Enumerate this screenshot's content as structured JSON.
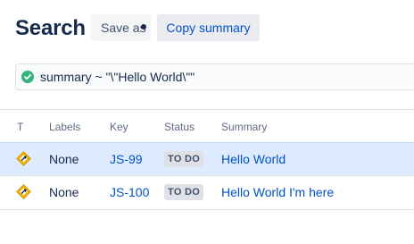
{
  "page": {
    "title": "Search"
  },
  "toolbar": {
    "save_label": "Save as",
    "copy_label": "Copy summary"
  },
  "query": {
    "jql": "summary ~ \"\\\"Hello World\\\"\"",
    "status_color": "#36b37e"
  },
  "table": {
    "columns": [
      "T",
      "Labels",
      "Key",
      "Status",
      "Summary"
    ],
    "rows": [
      {
        "type_icon": "issue-type-icon",
        "labels": "None",
        "key": "JS-99",
        "status": "TO DO",
        "summary": "Hello World",
        "selected": true
      },
      {
        "type_icon": "issue-type-icon",
        "labels": "None",
        "key": "JS-100",
        "status": "TO DO",
        "summary": "Hello World I'm here",
        "selected": false
      }
    ]
  },
  "colors": {
    "link": "#0052cc",
    "selected_row": "#deebff",
    "text": "#172b4d"
  }
}
